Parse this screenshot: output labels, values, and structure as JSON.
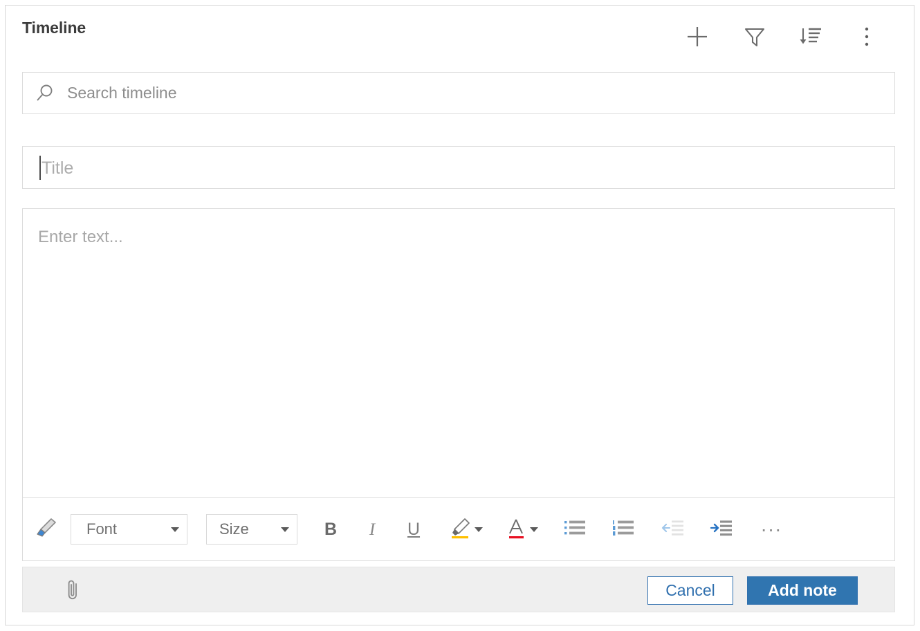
{
  "panel": {
    "title": "Timeline",
    "accent_color": "#3075b0",
    "border_color": "#d6d6d6"
  },
  "header": {
    "actions": [
      {
        "name": "add",
        "icon": "plus-icon",
        "tooltip": "Add"
      },
      {
        "name": "filter",
        "icon": "funnel-icon",
        "tooltip": "Filter"
      },
      {
        "name": "sort",
        "icon": "sort-descending-icon",
        "tooltip": "Sort"
      },
      {
        "name": "more",
        "icon": "more-vertical-icon",
        "tooltip": "More options"
      }
    ]
  },
  "search": {
    "icon": "search-icon",
    "placeholder": "Search timeline",
    "value": ""
  },
  "note_form": {
    "title_field": {
      "placeholder": "Title",
      "value": "",
      "focused": true
    },
    "body_field": {
      "placeholder": "Enter text...",
      "value": ""
    },
    "toolbar": {
      "format_painter": "format-painter-icon",
      "font": {
        "label": "Font",
        "value": ""
      },
      "size": {
        "label": "Size",
        "value": ""
      },
      "bold": "B",
      "italic": "I",
      "underline": "U",
      "highlight": "highlighter-icon",
      "font_color": "font-color-icon",
      "bulleted_list": "bulleted-list-icon",
      "numbered_list": "numbered-list-icon",
      "decrease_indent": "decrease-indent-icon",
      "increase_indent": "increase-indent-icon",
      "overflow": "···",
      "highlight_color": "#ffc000",
      "font_color_swatch": "#e81123"
    },
    "actions": {
      "attach": "paperclip-icon",
      "cancel_label": "Cancel",
      "submit_label": "Add note"
    }
  }
}
